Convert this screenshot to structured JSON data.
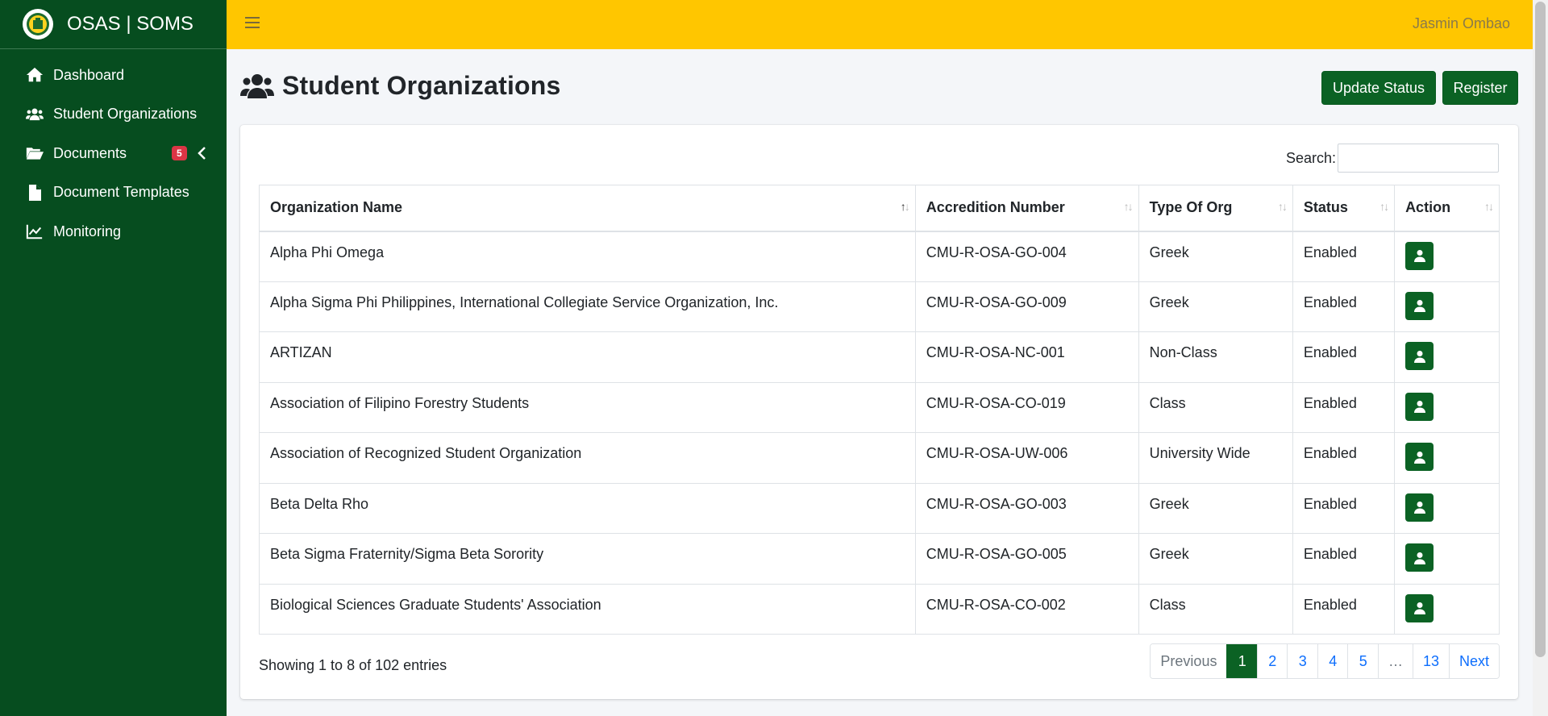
{
  "app": {
    "title": "OSAS | SOMS"
  },
  "topbar": {
    "username": "Jasmin Ombao"
  },
  "sidebar": {
    "items": [
      {
        "label": "Dashboard",
        "icon": "home-icon"
      },
      {
        "label": "Student Organizations",
        "icon": "users-icon"
      },
      {
        "label": "Documents",
        "icon": "folder-open-icon",
        "badge": "5"
      },
      {
        "label": "Document Templates",
        "icon": "file-icon"
      },
      {
        "label": "Monitoring",
        "icon": "chart-line-icon"
      }
    ]
  },
  "page": {
    "title": "Student Organizations",
    "update_status_label": "Update Status",
    "register_label": "Register"
  },
  "search": {
    "label": "Search:",
    "value": ""
  },
  "table": {
    "columns": [
      "Organization Name",
      "Accredition Number",
      "Type Of Org",
      "Status",
      "Action"
    ],
    "rows": [
      {
        "name": "Alpha Phi Omega",
        "accreditation": "CMU-R-OSA-GO-004",
        "type": "Greek",
        "status": "Enabled"
      },
      {
        "name": "Alpha Sigma Phi Philippines, International Collegiate Service Organization, Inc.",
        "accreditation": "CMU-R-OSA-GO-009",
        "type": "Greek",
        "status": "Enabled"
      },
      {
        "name": "ARTIZAN",
        "accreditation": "CMU-R-OSA-NC-001",
        "type": "Non-Class",
        "status": "Enabled"
      },
      {
        "name": "Association of Filipino Forestry Students",
        "accreditation": "CMU-R-OSA-CO-019",
        "type": "Class",
        "status": "Enabled"
      },
      {
        "name": "Association of Recognized Student Organization",
        "accreditation": "CMU-R-OSA-UW-006",
        "type": "University Wide",
        "status": "Enabled"
      },
      {
        "name": "Beta Delta Rho",
        "accreditation": "CMU-R-OSA-GO-003",
        "type": "Greek",
        "status": "Enabled"
      },
      {
        "name": "Beta Sigma Fraternity/Sigma Beta Sorority",
        "accreditation": "CMU-R-OSA-GO-005",
        "type": "Greek",
        "status": "Enabled"
      },
      {
        "name": "Biological Sciences Graduate Students' Association",
        "accreditation": "CMU-R-OSA-CO-002",
        "type": "Class",
        "status": "Enabled"
      }
    ]
  },
  "footer": {
    "info": "Showing 1 to 8 of 102 entries",
    "pagination": [
      "Previous",
      "1",
      "2",
      "3",
      "4",
      "5",
      "…",
      "13",
      "Next"
    ]
  },
  "colors": {
    "sidebar": "#064d1f",
    "topbar": "#ffc600",
    "accent": "#0b6224",
    "badge": "#dc3545"
  }
}
